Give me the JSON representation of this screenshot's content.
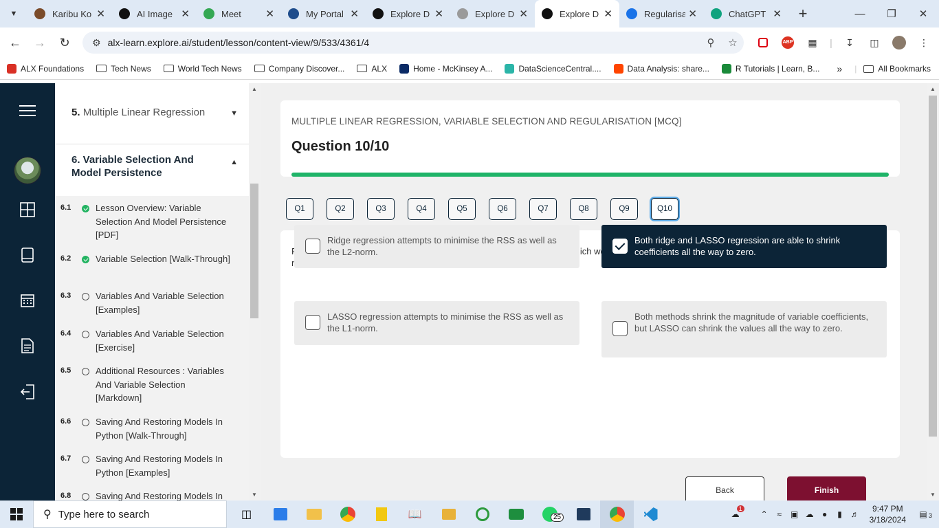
{
  "browser": {
    "tabs": [
      {
        "label": "Karibu Ko",
        "fav": "#7a4b2a"
      },
      {
        "label": "AI Image",
        "fav": "#111111"
      },
      {
        "label": "Meet",
        "fav": "#34a853"
      },
      {
        "label": "My Portal",
        "fav": "#1f4d8c"
      },
      {
        "label": "Explore D",
        "fav": "#111111"
      },
      {
        "label": "Explore D",
        "fav": "#9a9a9a"
      },
      {
        "label": "Explore D",
        "fav": "#111111",
        "active": true
      },
      {
        "label": "Regularisa",
        "fav": "#1a73e8"
      },
      {
        "label": "ChatGPT",
        "fav": "#10a37f"
      }
    ],
    "url": "alx-learn.explore.ai/student/lesson/content-view/9/533/4361/4",
    "bookmarks": [
      "ALX Foundations",
      "Tech News",
      "World Tech News",
      "Company Discover...",
      "ALX",
      "Home - McKinsey A...",
      "DataScienceCentral....",
      "Data Analysis: share...",
      "R Tutorials | Learn, B..."
    ],
    "all_bookmarks": "All Bookmarks"
  },
  "sidebar": {
    "sec5": {
      "num": "5.",
      "title": "Multiple Linear Regression"
    },
    "sec6": {
      "title": "6. Variable Selection And Model Persistence"
    },
    "lessons": [
      {
        "num": "6.1",
        "done": true,
        "text": "Lesson Overview: Variable Selection And Model Persistence [PDF]"
      },
      {
        "num": "6.2",
        "done": true,
        "text": "Variable Selection [Walk-Through]"
      },
      {
        "num": "6.3",
        "done": false,
        "text": "Variables And Variable Selection [Examples]"
      },
      {
        "num": "6.4",
        "done": false,
        "text": "Variables And Variable Selection [Exercise]"
      },
      {
        "num": "6.5",
        "done": false,
        "text": "Additional Resources : Variables And Variable Selection [Markdown]"
      },
      {
        "num": "6.6",
        "done": false,
        "text": "Saving And Restoring Models In Python [Walk-Through]"
      },
      {
        "num": "6.7",
        "done": false,
        "text": "Saving And Restoring Models In Python [Examples]"
      },
      {
        "num": "6.8",
        "done": false,
        "text": "Saving And Restoring Models In"
      }
    ]
  },
  "quiz": {
    "subtitle": "MULTIPLE LINEAR REGRESSION, VARIABLE SELECTION AND REGULARISATION [MCQ]",
    "question_title": "Question 10/10",
    "progress": 1.0,
    "progress_color": "#1fb468",
    "nav": [
      "Q1",
      "Q2",
      "Q3",
      "Q4",
      "Q5",
      "Q6",
      "Q7",
      "Q8",
      "Q9",
      "Q10"
    ],
    "current": 10,
    "prompt": "Ridge and LASSO regression are known as regularisation techniques which we can use to improve a linear regression model. Which statement regarding these techniques is FALSE?",
    "options": [
      {
        "text": "Ridge regression attempts to minimise the RSS as well as the L2-norm.",
        "selected": false
      },
      {
        "text": "Both ridge and LASSO regression are able to shrink coefficients all the way to zero.",
        "selected": true
      },
      {
        "text": "LASSO regression attempts to minimise the RSS as well as the L1-norm.",
        "selected": false
      },
      {
        "text": "Both methods shrink the magnitude of variable coefficients, but LASSO can shrink the values all the way to zero.",
        "selected": false
      }
    ],
    "back_label": "Back",
    "finish_label": "Finish",
    "finish_color": "#7d1030"
  },
  "taskbar": {
    "search_placeholder": "Type here to search",
    "whatsapp_badge": "25",
    "weather_badge": "1",
    "time": "9:47 PM",
    "date": "3/18/2024",
    "notif_count": "3"
  }
}
